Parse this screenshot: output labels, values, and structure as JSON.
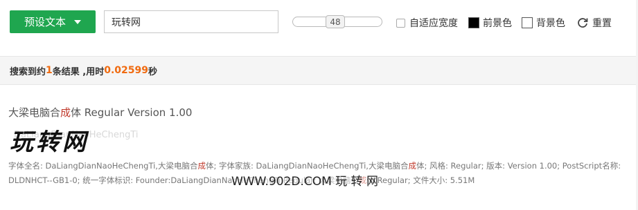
{
  "toolbar": {
    "preset_button": "预设文本",
    "text_input_value": "玩转网",
    "font_size_value": "48",
    "auto_width_label": "自适应宽度",
    "foreground_label": "前景色",
    "background_label": "背景色",
    "reset_label": "重置",
    "foreground_color": "#000000",
    "background_color": "#ffffff",
    "accent_color": "#1fa64f"
  },
  "results": {
    "prefix": "搜索到约",
    "count": "1",
    "middle": "条结果 ,用时",
    "time": "0.02599",
    "suffix": "秒"
  },
  "font_card": {
    "title_part1": "大梁电脑合",
    "title_highlight": "成",
    "title_part2": "体 Regular Version 1.00",
    "preview_text": "玩转网",
    "preview_faint": "DaLiangDianNaoHeChengTi",
    "info_line1_a": "字体全名: DaLiangDianNaoHeChengTi,大梁电脑合",
    "info_line1_hl1": "成",
    "info_line1_b": "体; 字体家族: DaLiangDianNaoHeChengTi,大梁电脑合",
    "info_line1_hl2": "成",
    "info_line1_c": "体; 风格: Regular; 版本: Version 1.00; PostScript名称:",
    "info_line2_a": "DLDNHCT--GB1-0; 统一字体标识: Founder:DaLiangDianNaoHeChengTi Regular; 大梁电脑合",
    "info_line2_hl": "成",
    "info_line2_b": "体 Regular;   文件大小:  5.51M",
    "watermark": "WWW.902D.COM 玩 转 网"
  }
}
